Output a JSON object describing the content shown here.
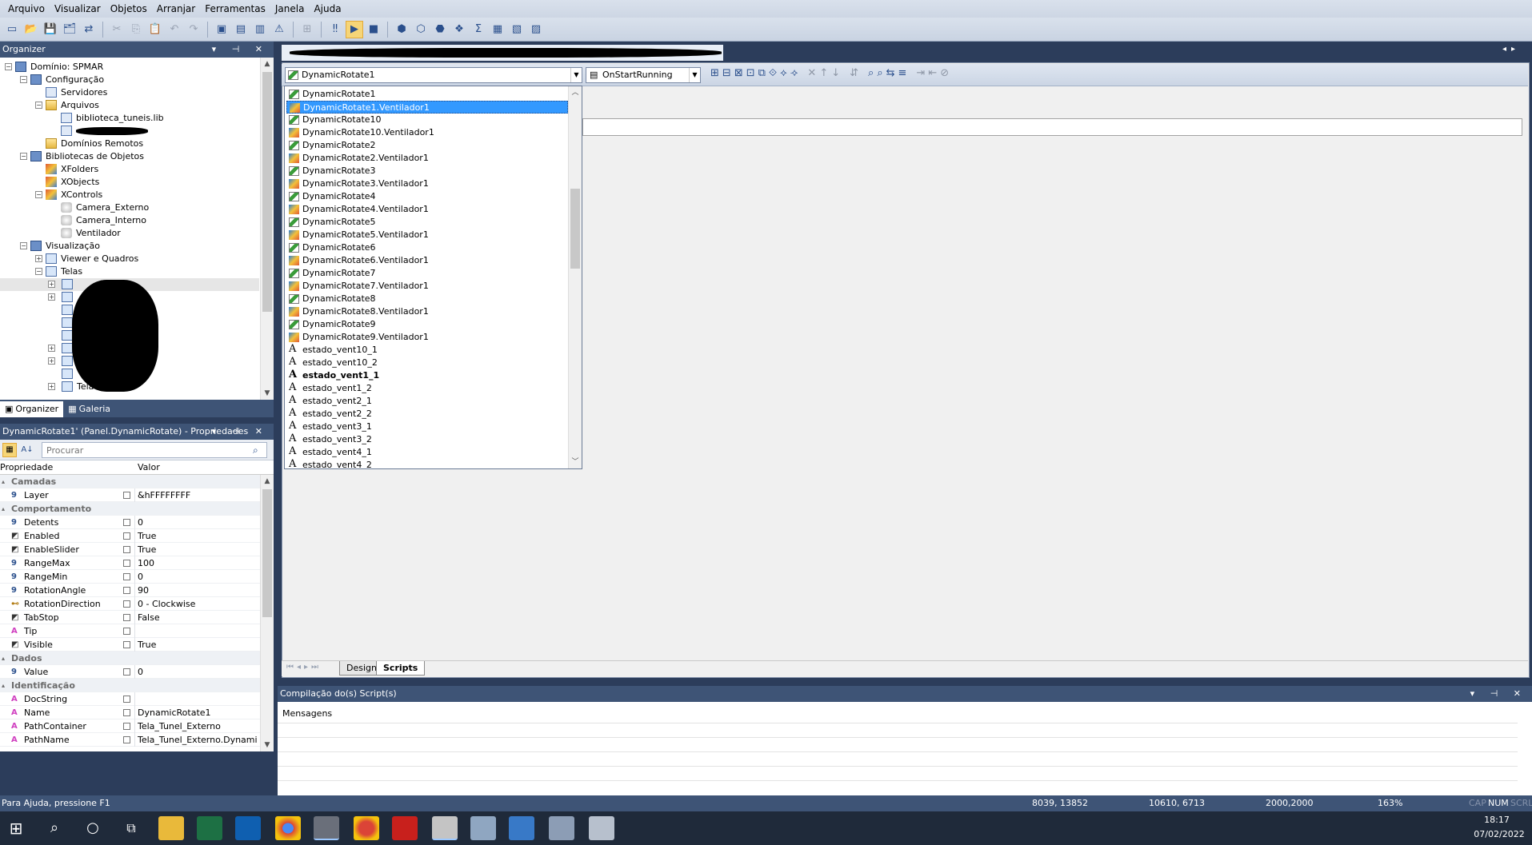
{
  "menu": [
    "Arquivo",
    "Visualizar",
    "Objetos",
    "Arranjar",
    "Ferramentas",
    "Janela",
    "Ajuda"
  ],
  "organizer": {
    "title": "Organizer",
    "tree": [
      {
        "label": "Domínio: SPMAR",
        "level": 0,
        "icon": "domain-icon",
        "exp": "-"
      },
      {
        "label": "Configuração",
        "level": 1,
        "icon": "config-icon",
        "exp": "-"
      },
      {
        "label": "Servidores",
        "level": 2,
        "icon": "server-icon",
        "exp": ""
      },
      {
        "label": "Arquivos",
        "level": 2,
        "icon": "folder-icon",
        "exp": "-"
      },
      {
        "label": "biblioteca_tuneis.lib",
        "level": 3,
        "icon": "library-file-icon",
        "exp": ""
      },
      {
        "label": "",
        "level": 3,
        "icon": "library-file-icon",
        "exp": ""
      },
      {
        "label": "Domínios Remotos",
        "level": 2,
        "icon": "folder-icon",
        "exp": ""
      },
      {
        "label": "Bibliotecas de Objetos",
        "level": 1,
        "icon": "library-icon",
        "exp": "-"
      },
      {
        "label": "XFolders",
        "level": 2,
        "icon": "xfolders-icon",
        "exp": ""
      },
      {
        "label": "XObjects",
        "level": 2,
        "icon": "xobjects-icon",
        "exp": ""
      },
      {
        "label": "XControls",
        "level": 2,
        "icon": "xcontrols-icon",
        "exp": "-"
      },
      {
        "label": "Camera_Externo",
        "level": 3,
        "icon": "xcontrol-item-icon",
        "exp": ""
      },
      {
        "label": "Camera_Interno",
        "level": 3,
        "icon": "xcontrol-item-icon",
        "exp": ""
      },
      {
        "label": "Ventilador",
        "level": 3,
        "icon": "xcontrol-item-icon",
        "exp": ""
      },
      {
        "label": "Visualização",
        "level": 1,
        "icon": "visualization-icon",
        "exp": "-"
      },
      {
        "label": "Viewer e Quadros",
        "level": 2,
        "icon": "viewer-icon",
        "exp": "+"
      },
      {
        "label": "Telas",
        "level": 2,
        "icon": "screens-icon",
        "exp": "-"
      }
    ],
    "partial_label": "Tela"
  },
  "bottom_tabs": [
    "Organizer",
    "Galeria"
  ],
  "properties": {
    "title": "DynamicRotate1' (Panel.DynamicRotate) - Propriedades",
    "search_placeholder": "Procurar",
    "col_name": "Propriedade",
    "col_value": "Valor",
    "rows": [
      {
        "cat": "Camadas"
      },
      {
        "name": "Layer",
        "value": "&hFFFFFFFF",
        "type": "9"
      },
      {
        "cat": "Comportamento"
      },
      {
        "name": "Detents",
        "value": "0",
        "type": "9"
      },
      {
        "name": "Enabled",
        "value": "True",
        "type": "b"
      },
      {
        "name": "EnableSlider",
        "value": "True",
        "type": "b"
      },
      {
        "name": "RangeMax",
        "value": "100",
        "type": "9"
      },
      {
        "name": "RangeMin",
        "value": "0",
        "type": "9"
      },
      {
        "name": "RotationAngle",
        "value": "90",
        "type": "9"
      },
      {
        "name": "RotationDirection",
        "value": "0 - Clockwise",
        "type": "e"
      },
      {
        "name": "TabStop",
        "value": "False",
        "type": "b"
      },
      {
        "name": "Tip",
        "value": "",
        "type": "A"
      },
      {
        "name": "Visible",
        "value": "True",
        "type": "b"
      },
      {
        "cat": "Dados"
      },
      {
        "name": "Value",
        "value": "0",
        "type": "9"
      },
      {
        "cat": "Identificação"
      },
      {
        "name": "DocString",
        "value": "",
        "type": "A"
      },
      {
        "name": "Name",
        "value": "DynamicRotate1",
        "type": "A"
      },
      {
        "name": "PathContainer",
        "value": "Tela_Tunel_Externo",
        "type": "A"
      },
      {
        "name": "PathName",
        "value": "Tela_Tunel_Externo.Dynami",
        "type": "A"
      }
    ]
  },
  "editor": {
    "object_combo": "DynamicRotate1",
    "event_combo": "OnStartRunning",
    "dropdown_items": [
      {
        "label": "DynamicRotate1",
        "kind": "rot"
      },
      {
        "label": "DynamicRotate1.Ventilador1",
        "kind": "vent",
        "selected": true
      },
      {
        "label": "DynamicRotate10",
        "kind": "rot"
      },
      {
        "label": "DynamicRotate10.Ventilador1",
        "kind": "vent"
      },
      {
        "label": "DynamicRotate2",
        "kind": "rot"
      },
      {
        "label": "DynamicRotate2.Ventilador1",
        "kind": "vent"
      },
      {
        "label": "DynamicRotate3",
        "kind": "rot"
      },
      {
        "label": "DynamicRotate3.Ventilador1",
        "kind": "vent"
      },
      {
        "label": "DynamicRotate4",
        "kind": "rot"
      },
      {
        "label": "DynamicRotate4.Ventilador1",
        "kind": "vent"
      },
      {
        "label": "DynamicRotate5",
        "kind": "rot"
      },
      {
        "label": "DynamicRotate5.Ventilador1",
        "kind": "vent"
      },
      {
        "label": "DynamicRotate6",
        "kind": "rot"
      },
      {
        "label": "DynamicRotate6.Ventilador1",
        "kind": "vent"
      },
      {
        "label": "DynamicRotate7",
        "kind": "rot"
      },
      {
        "label": "DynamicRotate7.Ventilador1",
        "kind": "vent"
      },
      {
        "label": "DynamicRotate8",
        "kind": "rot"
      },
      {
        "label": "DynamicRotate8.Ventilador1",
        "kind": "vent"
      },
      {
        "label": "DynamicRotate9",
        "kind": "rot"
      },
      {
        "label": "DynamicRotate9.Ventilador1",
        "kind": "vent"
      },
      {
        "label": "estado_vent10_1",
        "kind": "A"
      },
      {
        "label": "estado_vent10_2",
        "kind": "A"
      },
      {
        "label": "estado_vent1_1",
        "kind": "A",
        "bold": true
      },
      {
        "label": "estado_vent1_2",
        "kind": "A"
      },
      {
        "label": "estado_vent2_1",
        "kind": "A"
      },
      {
        "label": "estado_vent2_2",
        "kind": "A"
      },
      {
        "label": "estado_vent3_1",
        "kind": "A"
      },
      {
        "label": "estado_vent3_2",
        "kind": "A"
      },
      {
        "label": "estado_vent4_1",
        "kind": "A"
      },
      {
        "label": "estado_vent4_2",
        "kind": "A"
      }
    ],
    "page_tabs": [
      "Design",
      "Scripts"
    ],
    "active_tab": "Scripts"
  },
  "compile": {
    "title": "Compilação do(s) Script(s)",
    "column": "Mensagens"
  },
  "status": {
    "help": "Para Ajuda, pressione F1",
    "pos1": "8039, 13852",
    "pos2": "10610, 6713",
    "size": "2000,2000",
    "zoom": "163%",
    "cap": "CAP",
    "num": "NUM",
    "scrl": "SCRL"
  },
  "taskbar": {
    "time": "18:17",
    "date": "07/02/2022"
  }
}
